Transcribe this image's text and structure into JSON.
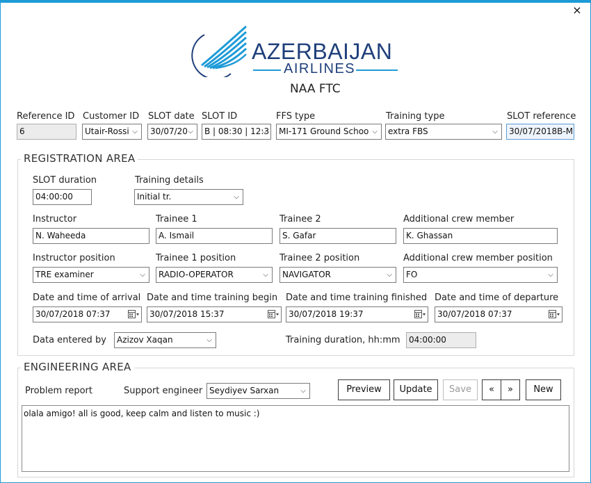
{
  "window": {
    "close_glyph": "×"
  },
  "brand": {
    "name_line1": "AZERBAIJAN",
    "name_line2": "AIRLINES",
    "subtitle": "NAA FTC",
    "accent": "#1e9bd7",
    "navy": "#1f3f7a"
  },
  "header": {
    "reference_id": {
      "label": "Reference ID",
      "value": "6"
    },
    "customer_id": {
      "label": "Customer ID",
      "value": "Utair-Rossi"
    },
    "slot_date": {
      "label": "SLOT date",
      "value": "30/07/20"
    },
    "slot_id": {
      "label": "SLOT ID",
      "value": "B | 08:30 | 12:3"
    },
    "ffs_type": {
      "label": "FFS type",
      "value": "MI-171 Ground Schoo"
    },
    "training_type": {
      "label": "Training type",
      "value": "extra FBS"
    },
    "slot_reference": {
      "label": "SLOT reference",
      "value": "30/07/2018B-M"
    }
  },
  "registration": {
    "title": "REGISTRATION AREA",
    "slot_duration": {
      "label": "SLOT duration",
      "value": "04:00:00"
    },
    "training_details": {
      "label": "Training details",
      "value": "Initial tr."
    },
    "instructor": {
      "label": "Instructor",
      "value": "N. Waheeda"
    },
    "trainee1": {
      "label": "Trainee 1",
      "value": "A. Ismail"
    },
    "trainee2": {
      "label": "Trainee 2",
      "value": "S. Gafar"
    },
    "additional_crew": {
      "label": "Additional crew member",
      "value": "K. Ghassan"
    },
    "instructor_position": {
      "label": "Instructor position",
      "value": "TRE examiner"
    },
    "trainee1_position": {
      "label": "Trainee 1 position",
      "value": "RADIO-OPERATOR"
    },
    "trainee2_position": {
      "label": "Trainee 2 position",
      "value": "NAVIGATOR"
    },
    "additional_crew_position": {
      "label": "Additional crew member position",
      "value": "FO"
    },
    "arrival": {
      "label": "Date and time of arrival",
      "value": "30/07/2018 07:37"
    },
    "training_begin": {
      "label": "Date and time training begin",
      "value": "30/07/2018 15:37"
    },
    "training_finished": {
      "label": "Date and time training finished",
      "value": "30/07/2018 19:37"
    },
    "departure": {
      "label": "Date and time of departure",
      "value": "30/07/2018 07:37"
    },
    "entered_by": {
      "label": "Data entered by",
      "value": "Azizov Xaqan"
    },
    "training_duration": {
      "label": "Training duration, hh:mm",
      "value": "04:00:00"
    }
  },
  "engineering": {
    "title": "ENGINEERING AREA",
    "problem_report_label": "Problem report",
    "support_engineer": {
      "label": "Support engineer",
      "value": "Seydiyev Sarxan"
    },
    "buttons": {
      "preview": "Preview",
      "update": "Update",
      "save": "Save",
      "prev": "«",
      "next": "»",
      "new": "New"
    },
    "report_text": "olala amigo! all is good, keep calm and listen to music :)"
  }
}
